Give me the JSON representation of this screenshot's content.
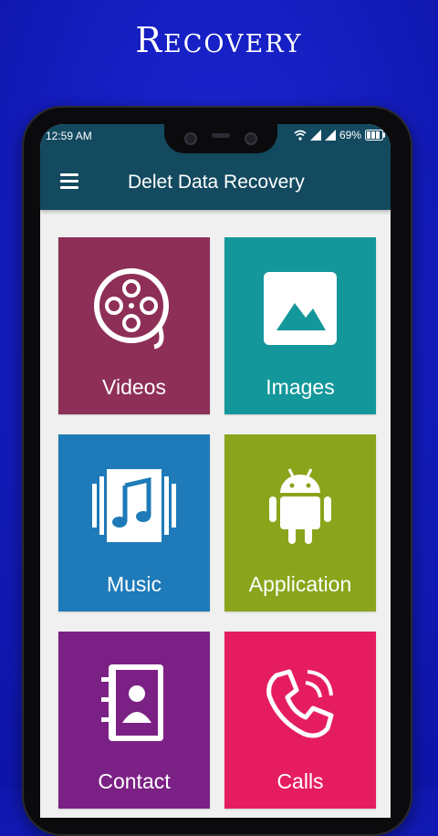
{
  "promo": {
    "title": "Recovery"
  },
  "status_bar": {
    "time": "12:59 AM",
    "battery": "69%"
  },
  "app_bar": {
    "title": "Delet Data Recovery"
  },
  "tiles": [
    {
      "label": "Videos",
      "icon": "film-reel-icon",
      "color": "#8e2f57"
    },
    {
      "label": "Images",
      "icon": "image-icon",
      "color": "#14979a"
    },
    {
      "label": "Music",
      "icon": "music-note-icon",
      "color": "#1e7ab8"
    },
    {
      "label": "Application",
      "icon": "android-icon",
      "color": "#8aa51b"
    },
    {
      "label": "Contact",
      "icon": "contact-book-icon",
      "color": "#7b2185"
    },
    {
      "label": "Calls",
      "icon": "phone-call-icon",
      "color": "#e51d60"
    }
  ]
}
